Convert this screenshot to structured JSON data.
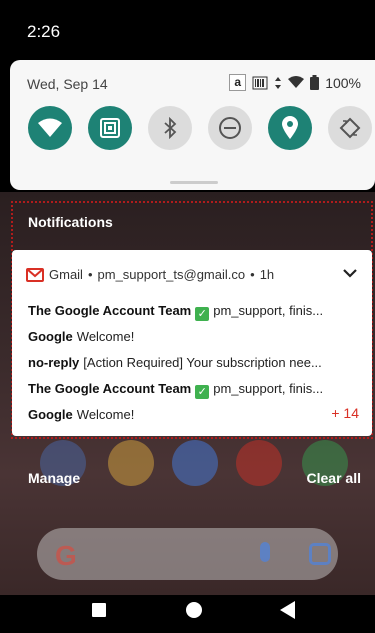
{
  "status": {
    "time": "2:26"
  },
  "quick_settings": {
    "date": "Wed, Sep 14",
    "battery": "100%",
    "tiles": [
      {
        "name": "wifi",
        "on": true
      },
      {
        "name": "nfc",
        "on": true
      },
      {
        "name": "bluetooth",
        "on": false
      },
      {
        "name": "do-not-disturb",
        "on": false
      },
      {
        "name": "location",
        "on": true
      },
      {
        "name": "auto-rotate",
        "on": false
      }
    ],
    "accent": "#1e8275"
  },
  "notifications": {
    "header": "Notifications",
    "card": {
      "app": "Gmail",
      "account": "pm_support_ts@gmail.co",
      "time": "1h",
      "rows": [
        {
          "sender": "The Google Account Team",
          "check": true,
          "text": "pm_support, finis..."
        },
        {
          "sender": "Google",
          "check": false,
          "text": "Welcome!"
        },
        {
          "sender": "no-reply",
          "check": false,
          "text": "[Action Required] Your subscription nee..."
        },
        {
          "sender": "The Google Account Team",
          "check": true,
          "text": "pm_support, finis..."
        },
        {
          "sender": "Google",
          "check": false,
          "text": "Welcome!"
        }
      ],
      "more": "+ 14"
    },
    "manage": "Manage",
    "clear_all": "Clear all"
  },
  "search": {
    "logo": "G"
  }
}
